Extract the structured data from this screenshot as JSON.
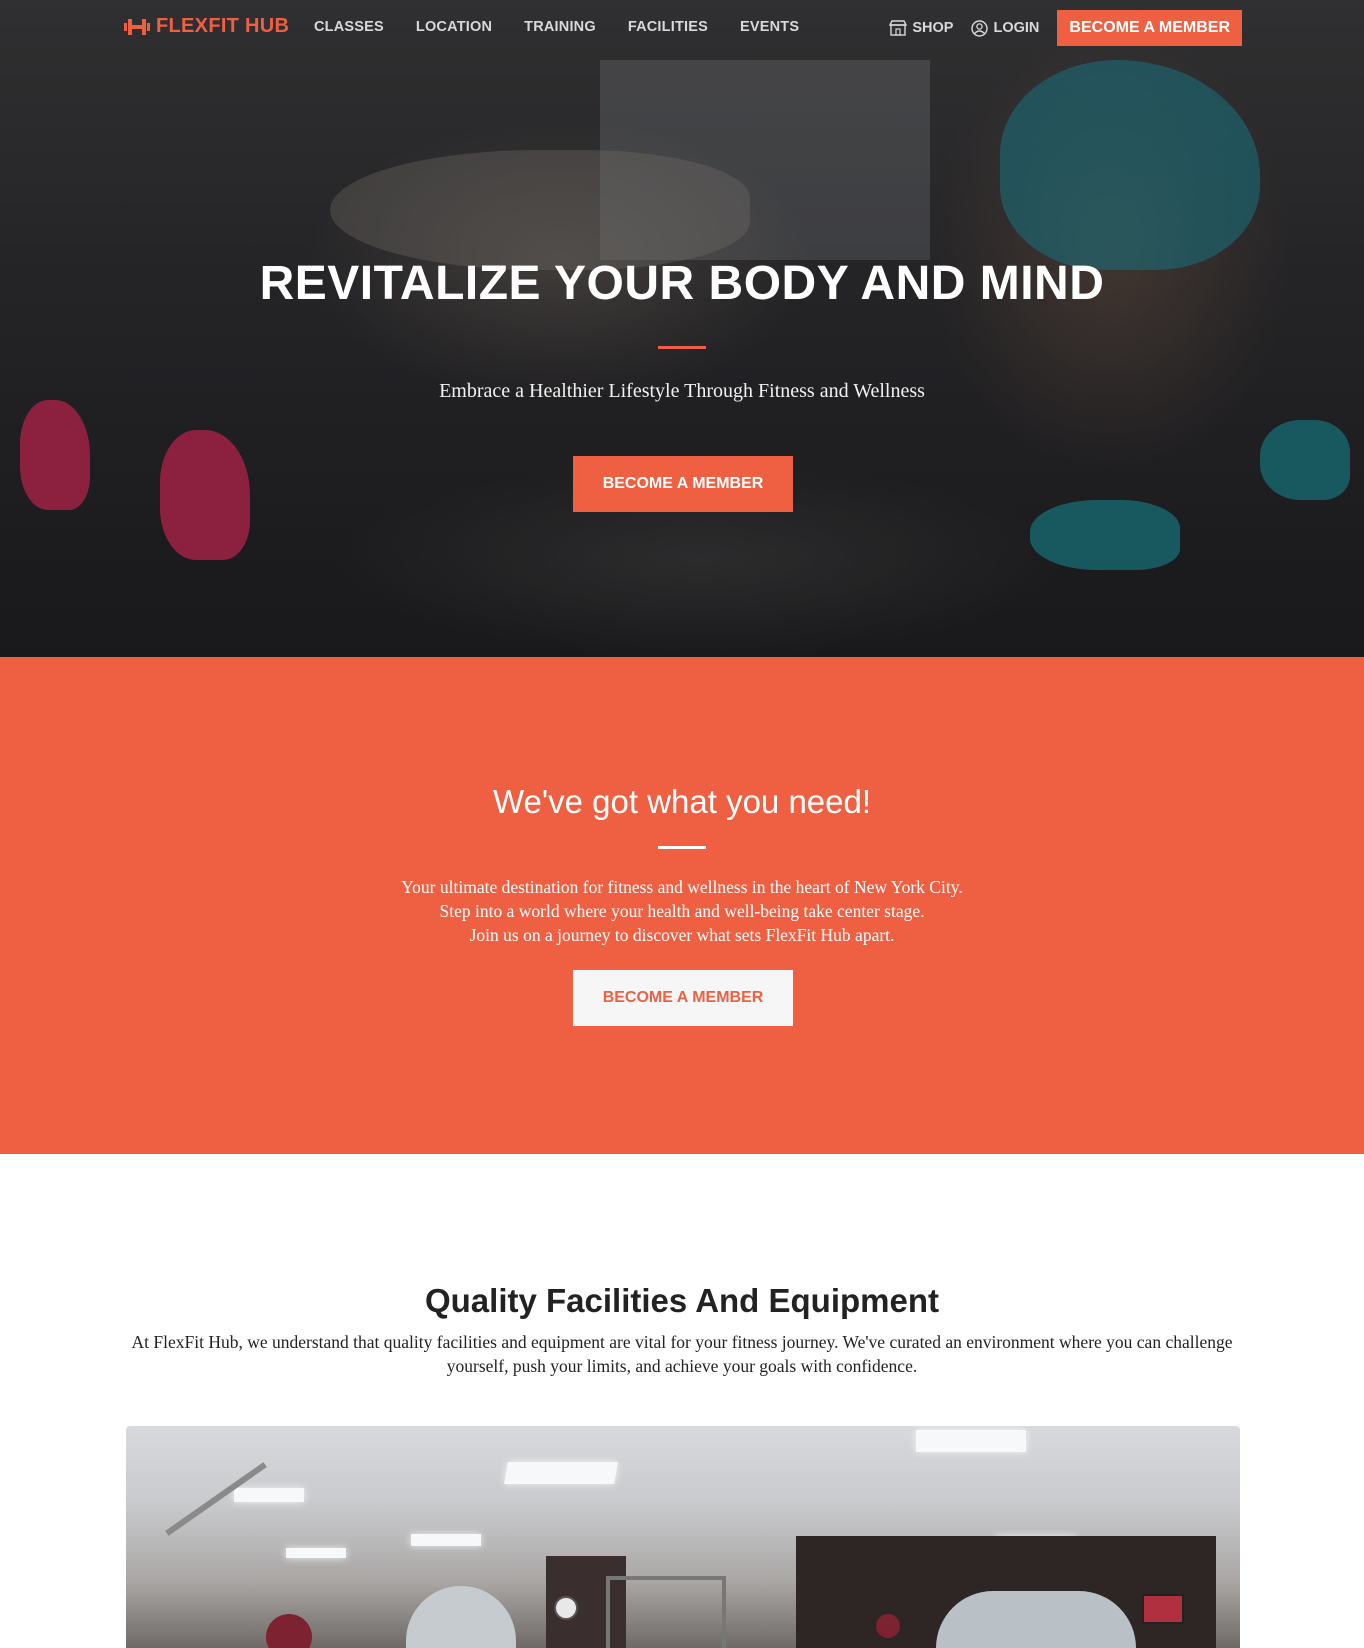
{
  "nav": {
    "brand": "FLEXFIT HUB",
    "links": [
      "CLASSES",
      "LOCATION",
      "TRAINING",
      "FACILITIES",
      "EVENTS"
    ],
    "shop": "SHOP",
    "login": "LOGIN",
    "cta": "BECOME A MEMBER"
  },
  "hero": {
    "title": "REVITALIZE YOUR BODY AND MIND",
    "subtitle": "Embrace a Healthier Lifestyle Through Fitness and Wellness",
    "button": "BECOME A MEMBER"
  },
  "need": {
    "title": "We've got what you need!",
    "lines": [
      "Your ultimate destination for fitness and wellness in the heart of New York City.",
      "Step into a world where your health and well-being take center stage.",
      "Join us on a journey to discover what sets FlexFit Hub apart."
    ],
    "button": "BECOME A MEMBER"
  },
  "facilities": {
    "title": "Quality Facilities And Equipment",
    "text": "At FlexFit Hub, we understand that quality facilities and equipment are vital for your fitness journey. We've curated an environment where you can challenge yourself, push your limits, and achieve your goals with confidence."
  },
  "colors": {
    "accent": "#ef5f42",
    "white": "#ffffff",
    "dark_text": "#222222"
  }
}
